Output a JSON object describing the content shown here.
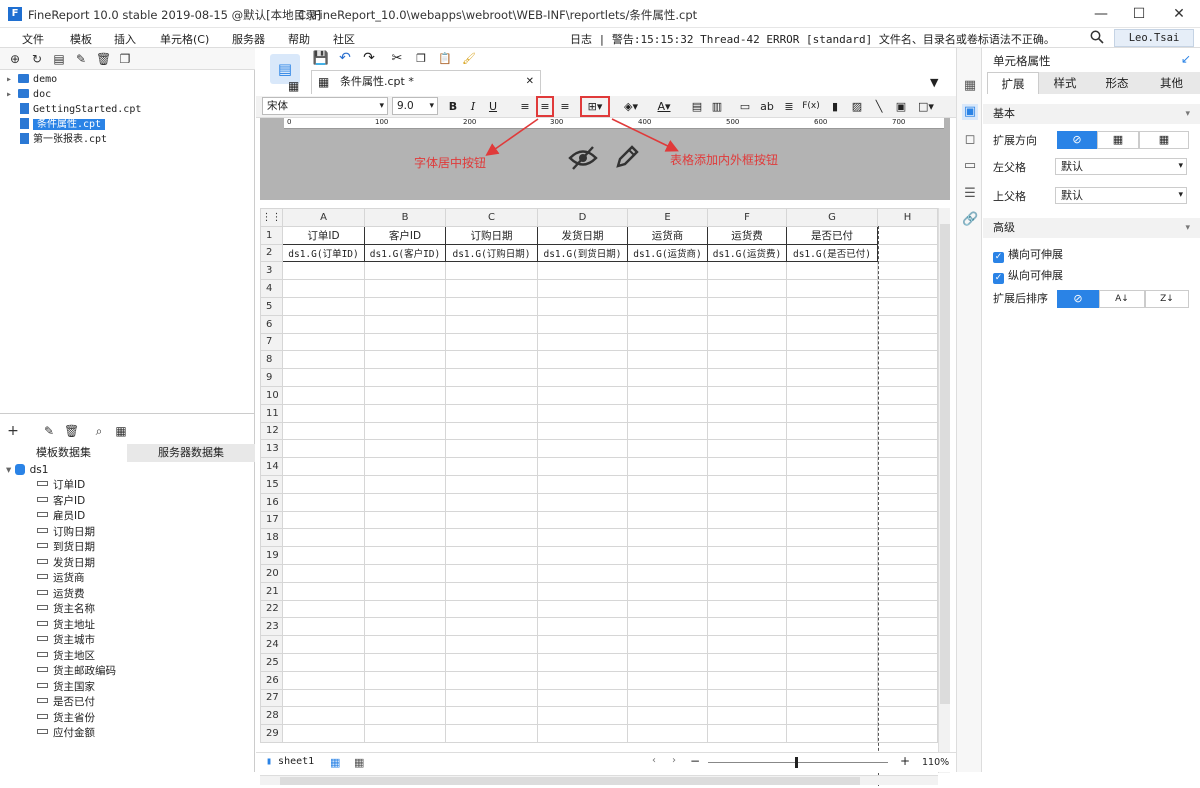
{
  "titlebar": {
    "logo": "F",
    "title": "FineReport 10.0 stable 2019-08-15 @默认[本地目录]",
    "path": "C:\\FineReport_10.0\\webapps\\webroot\\WEB-INF\\reportlets/条件属性.cpt",
    "minimize": "—",
    "maximize": "☐",
    "close": "✕"
  },
  "menu": {
    "items": [
      "文件",
      "模板",
      "插入",
      "单元格(C)",
      "服务器",
      "帮助",
      "社区"
    ],
    "log": "日志 | 警告:15:15:32 Thread-42 ERROR [standard] 文件名、目录名或卷标语法不正确。",
    "user": "Leo.Tsai"
  },
  "filetree": {
    "items": [
      {
        "label": "demo",
        "kind": "folder"
      },
      {
        "label": "doc",
        "kind": "folder"
      },
      {
        "label": "GettingStarted.cpt",
        "kind": "file"
      },
      {
        "label": "条件属性.cpt",
        "kind": "file",
        "selected": true
      },
      {
        "label": "第一张报表.cpt",
        "kind": "file"
      }
    ]
  },
  "dataset_panel": {
    "tabs": [
      "模板数据集",
      "服务器数据集"
    ],
    "dataset": "ds1",
    "fields": [
      "订单ID",
      "客户ID",
      "雇员ID",
      "订购日期",
      "到货日期",
      "发货日期",
      "运货商",
      "运货费",
      "货主名称",
      "货主地址",
      "货主城市",
      "货主地区",
      "货主邮政编码",
      "货主国家",
      "是否已付",
      "货主省份",
      "应付金额"
    ]
  },
  "editor": {
    "tab_label": "条件属性.cpt *",
    "font_name": "宋体",
    "font_size": "9.0",
    "ruler_ticks": [
      "0",
      "100",
      "200",
      "300",
      "400",
      "500",
      "600",
      "700"
    ],
    "annotation_center": "字体居中按钮",
    "annotation_border": "表格添加内外框按钮"
  },
  "sheet": {
    "columns": [
      "A",
      "B",
      "C",
      "D",
      "E",
      "F",
      "G",
      "H"
    ],
    "header_row": [
      "订单ID",
      "客户ID",
      "订购日期",
      "发货日期",
      "运货商",
      "运货费",
      "是否已付"
    ],
    "data_row": [
      "ds1.G(订单ID)",
      "ds1.G(客户ID)",
      "ds1.G(订购日期)",
      "ds1.G(到货日期)",
      "ds1.G(运货商)",
      "ds1.G(运货费)",
      "ds1.G(是否已付)"
    ],
    "row_count": 29,
    "sheet_tab": "sheet1",
    "zoom": "110%"
  },
  "properties": {
    "title": "单元格属性",
    "tabs": [
      "扩展",
      "样式",
      "形态",
      "其他"
    ],
    "section_basic": "基本",
    "expand_direction_label": "扩展方向",
    "left_parent_label": "左父格",
    "left_parent_value": "默认",
    "top_parent_label": "上父格",
    "top_parent_value": "默认",
    "section_advanced": "高级",
    "h_expand": "横向可伸展",
    "v_expand": "纵向可伸展",
    "sort_label": "扩展后排序"
  },
  "colors": {
    "accent": "#2a83e6",
    "annotation": "#e03a3a"
  }
}
